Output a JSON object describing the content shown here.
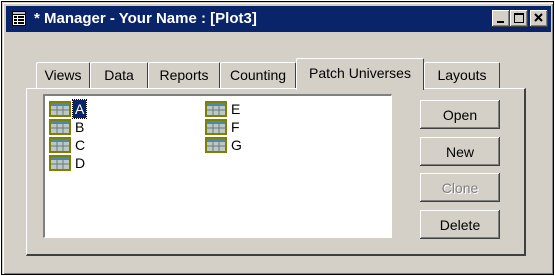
{
  "window": {
    "title": "* Manager - Your Name : [Plot3]",
    "icon": "app-grid-icon",
    "controls": [
      "minimize-icon",
      "maximize-icon",
      "close-icon"
    ]
  },
  "tabs": [
    {
      "label": "Views",
      "active": false
    },
    {
      "label": "Data",
      "active": false
    },
    {
      "label": "Reports",
      "active": false
    },
    {
      "label": "Counting",
      "active": false
    },
    {
      "label": "Patch Universes",
      "active": true
    },
    {
      "label": "Layouts",
      "active": false
    }
  ],
  "universes": {
    "item_icon": "grid-icon",
    "items": [
      {
        "label": "A",
        "selected": true
      },
      {
        "label": "B",
        "selected": false
      },
      {
        "label": "C",
        "selected": false
      },
      {
        "label": "D",
        "selected": false
      },
      {
        "label": "E",
        "selected": false
      },
      {
        "label": "F",
        "selected": false
      },
      {
        "label": "G",
        "selected": false
      }
    ]
  },
  "buttons": {
    "open": "Open",
    "new": "New",
    "clone": "Clone",
    "delete": "Delete"
  },
  "colors": {
    "titlebar": "#0a246a",
    "face": "#d4d0c8",
    "selection": "#0a246a"
  }
}
